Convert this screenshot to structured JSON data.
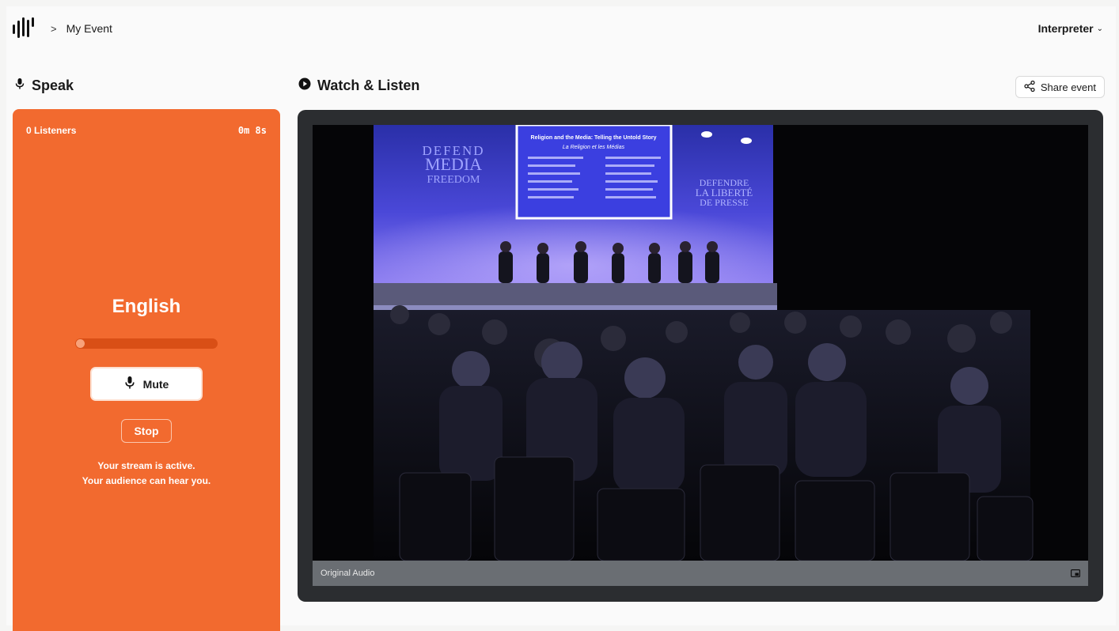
{
  "header": {
    "breadcrumb_separator": ">",
    "event_name": "My Event",
    "role_label": "Interpreter",
    "role_chevron": "⌄"
  },
  "speak": {
    "title": "Speak",
    "listeners": "0 Listeners",
    "elapsed": "0m 8s",
    "language": "English",
    "audio_level": 0.03,
    "mute_label": "Mute",
    "stop_label": "Stop",
    "status_line1": "Your stream is active.",
    "status_line2": "Your audience can hear you."
  },
  "watch": {
    "title": "Watch & Listen",
    "share_label": "Share event",
    "audio_track": "Original Audio",
    "stage_left_sign": [
      "DEFEND",
      "MEDIA",
      "FREEDOM"
    ],
    "stage_right_sign": [
      "DEFENDRE",
      "LA LIBERTÉ",
      "DE PRESSE"
    ],
    "screen_title": "Religion and the Media: Telling the Untold Story",
    "screen_subtitle": "La Religion et les Médias"
  },
  "colors": {
    "accent": "#f26a2f",
    "panel_dark": "#2b2d30",
    "background": "#fafafa"
  },
  "icons": {
    "logo": "waveform-logo-icon",
    "speak": "microphone-icon",
    "watch": "play-circle-icon",
    "share": "share-icon",
    "mute": "microphone-icon",
    "pip": "picture-in-picture-icon"
  }
}
